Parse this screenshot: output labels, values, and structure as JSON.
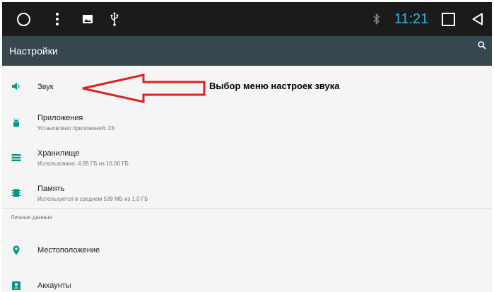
{
  "status_bar": {
    "time": "11:21",
    "icons": [
      "home-circle-icon",
      "more-vert-icon",
      "image-icon",
      "usb-icon",
      "bluetooth-icon",
      "recents-square-icon",
      "back-triangle-icon"
    ],
    "time_color": "#33b5e5"
  },
  "toolbar": {
    "title": "Настройки",
    "background": "#37474f",
    "accent": "#009688"
  },
  "settings": {
    "sound": {
      "title": "Звук",
      "icon": "volume-icon"
    },
    "apps": {
      "title": "Приложения",
      "subtitle": "Установлено приложений: 23",
      "icon": "android-icon"
    },
    "storage": {
      "title": "Хранилище",
      "subtitle": "Использовано: 4,95 ГБ из 16,00 ГБ",
      "icon": "storage-icon"
    },
    "memory": {
      "title": "Память",
      "subtitle": "Используется в среднем 539 МБ из 1,0 ГБ",
      "icon": "memory-icon"
    }
  },
  "personal": {
    "header": "Личные данные",
    "location": {
      "title": "Местоположение",
      "icon": "location-pin-icon"
    },
    "accounts": {
      "title": "Аккаунты",
      "icon": "account-icon"
    }
  },
  "annotation": {
    "text": "Выбор меню настроек звука",
    "arrow_color": "#e02020"
  }
}
